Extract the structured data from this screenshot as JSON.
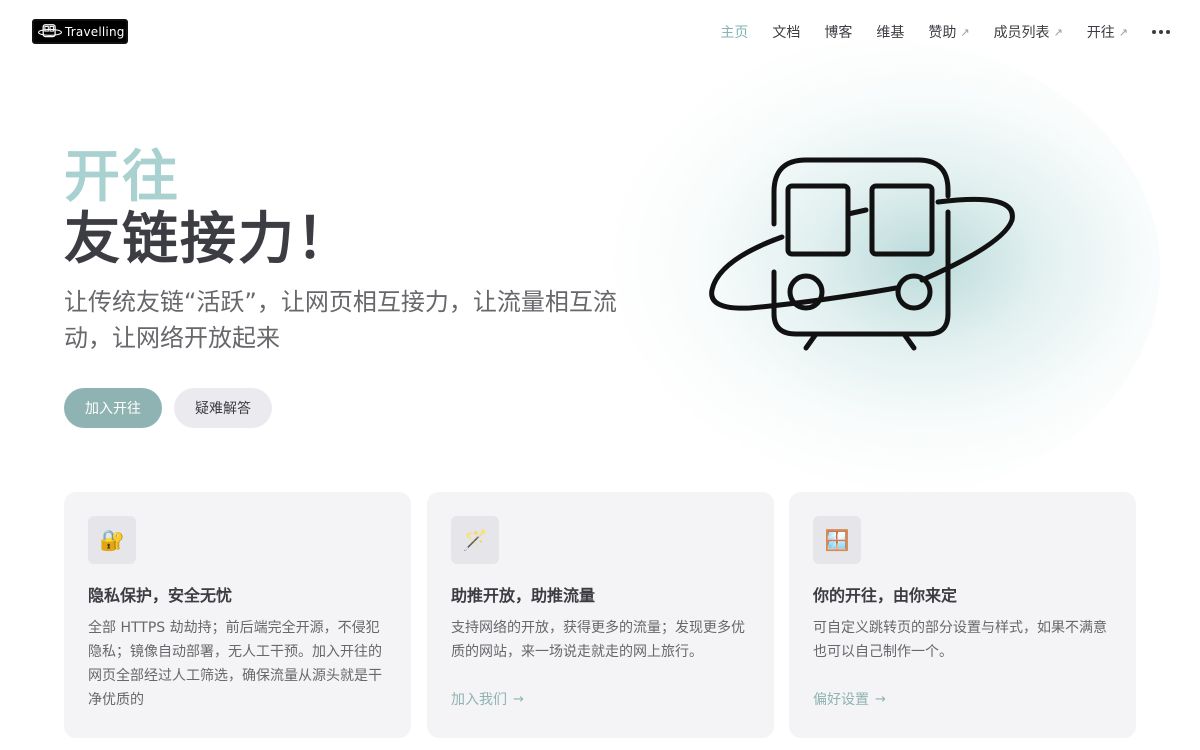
{
  "nav": {
    "logo_text": "Travelling",
    "items": [
      {
        "label": "主页",
        "external": false,
        "active": true
      },
      {
        "label": "文档",
        "external": false,
        "active": false
      },
      {
        "label": "博客",
        "external": false,
        "active": false
      },
      {
        "label": "维基",
        "external": false,
        "active": false
      },
      {
        "label": "赞助",
        "external": true,
        "active": false
      },
      {
        "label": "成员列表",
        "external": true,
        "active": false
      },
      {
        "label": "开往",
        "external": true,
        "active": false
      }
    ],
    "external_glyph": "↗",
    "more_icon": "ellipsis-icon"
  },
  "hero": {
    "name": "开往",
    "text": "友链接力！",
    "tagline": "让传统友链“活跃”，让网页相互接力，让流量相互流动，让网络开放起来",
    "actions": [
      {
        "label": "加入开往",
        "theme": "brand"
      },
      {
        "label": "疑难解答",
        "theme": "alt"
      }
    ],
    "image_icon": "train-logo-icon"
  },
  "features": [
    {
      "icon": "🔐",
      "icon_name": "lock-key-icon",
      "title": "隐私保护，安全无忧",
      "details": "全部 HTTPS 劫劫持；前后端完全开源，不侵犯隐私；镜像自动部署，无人工干预。加入开往的网页全部经过人工筛选，确保流量从源头就是干净优质的",
      "link": ""
    },
    {
      "icon": "🪄",
      "icon_name": "magic-wand-icon",
      "title": "助推开放，助推流量",
      "details": "支持网络的开放，获得更多的流量；发现更多优质的网站，来一场说走就走的网上旅行。",
      "link": "加入我们"
    },
    {
      "icon": "🪟",
      "icon_name": "window-icon",
      "title": "你的开往，由你来定",
      "details": "可自定义跳转页的部分设置与样式，如果不满意也可以自己制作一个。",
      "link": "偏好设置"
    }
  ],
  "link_arrow": "→",
  "colors": {
    "brand": "#8fb3b2",
    "brand_light": "#a8d1cf",
    "text": "#3c3c43",
    "text_muted": "#67676c",
    "card_bg": "#f4f4f6"
  }
}
